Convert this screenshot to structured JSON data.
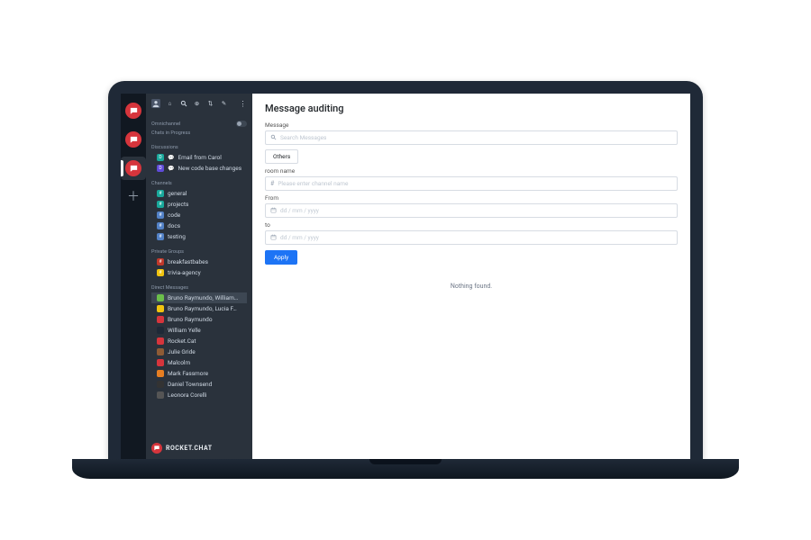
{
  "rail": {
    "workspaces": [
      {
        "name": "workspace-1"
      },
      {
        "name": "workspace-2"
      },
      {
        "name": "workspace-3",
        "active": true
      }
    ]
  },
  "sidebar": {
    "omnichannel_label": "Omnichannel",
    "chats_in_progress_label": "Chats in Progress",
    "discussions": {
      "header": "Discussions",
      "items": [
        {
          "label": "Email from Carol",
          "icon_bg": "#19a99c"
        },
        {
          "label": "New code base changes",
          "icon_bg": "#5f4bd9"
        }
      ]
    },
    "channels": {
      "header": "Channels",
      "items": [
        {
          "label": "general",
          "icon_bg": "#19a99c"
        },
        {
          "label": "projects",
          "icon_bg": "#19a99c"
        },
        {
          "label": "code",
          "icon_bg": "#5382c7"
        },
        {
          "label": "docs",
          "icon_bg": "#5382c7"
        },
        {
          "label": "testing",
          "icon_bg": "#5382c7"
        }
      ]
    },
    "private_groups": {
      "header": "Private Groups",
      "items": [
        {
          "label": "breakfastbabes",
          "icon_bg": "#c0392b"
        },
        {
          "label": "trivia-agency",
          "icon_bg": "#f1c40f"
        }
      ]
    },
    "direct_messages": {
      "header": "Direct Messages",
      "items": [
        {
          "label": "Bruno Raymundo, William…",
          "avatar_bg": "#6bbf4a",
          "selected": true
        },
        {
          "label": "Bruno Raymundo, Lucia F…",
          "avatar_bg": "#f1c40f"
        },
        {
          "label": "Bruno Raymundo",
          "avatar_bg": "#d6353c"
        },
        {
          "label": "William Yelle",
          "avatar_bg": "#1f2937"
        },
        {
          "label": "Rocket.Cat",
          "avatar_bg": "#d6353c"
        },
        {
          "label": "Julie Gride",
          "avatar_bg": "#8e5b35"
        },
        {
          "label": "Malcolm",
          "avatar_bg": "#d6353c"
        },
        {
          "label": "Mark Fassmore",
          "avatar_bg": "#e67e22"
        },
        {
          "label": "Daniel Townsend",
          "avatar_bg": "#333"
        },
        {
          "label": "Leonora Corelli",
          "avatar_bg": "#555"
        }
      ]
    },
    "brand": "ROCKET.CHAT"
  },
  "main": {
    "title": "Message auditing",
    "message_label": "Message",
    "message_placeholder": "Search Messages",
    "others_label": "Others",
    "room_label": "room name",
    "room_placeholder": "Please enter channel name",
    "from_label": "From",
    "to_label": "to",
    "date_placeholder": "dd / mm / yyyy",
    "apply_label": "Apply",
    "empty_text": "Nothing found."
  }
}
